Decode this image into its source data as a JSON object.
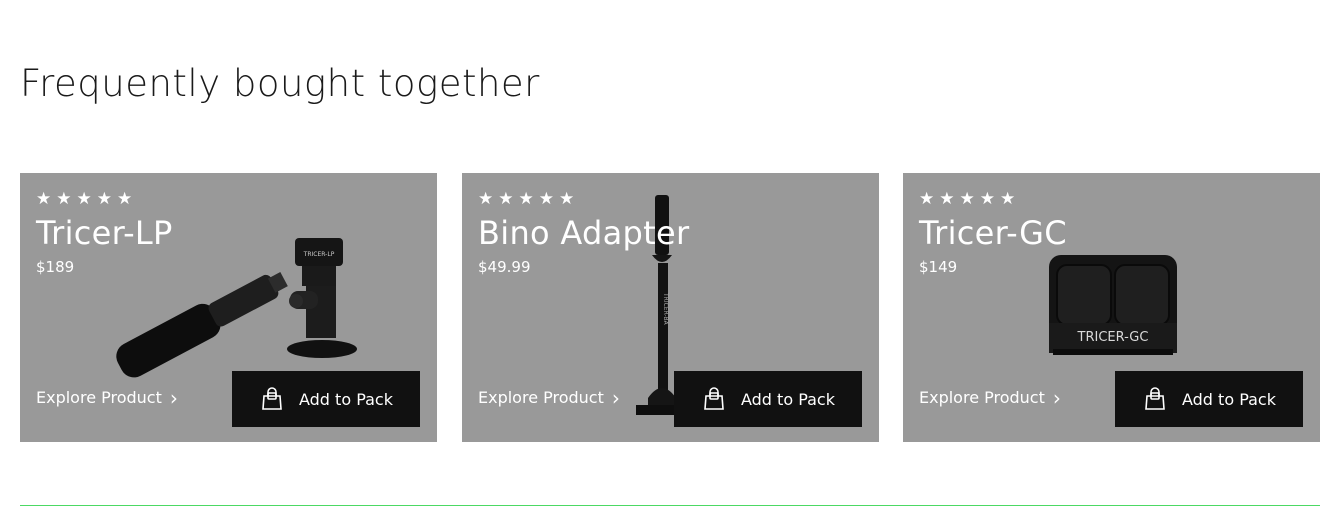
{
  "section": {
    "title": "Frequently bought together"
  },
  "products": [
    {
      "stars": "★★★★★",
      "name": "Tricer-LP",
      "price": "$189",
      "explore_label": "Explore Product",
      "chevron": "›",
      "add_label": "Add to Pack",
      "image_label": "TRICER-LP"
    },
    {
      "stars": "★★★★★",
      "name": "Bino Adapter",
      "price": "$49.99",
      "explore_label": "Explore Product",
      "chevron": "›",
      "add_label": "Add to Pack",
      "image_label": "TRICER-BA"
    },
    {
      "stars": "★★★★★",
      "name": "Tricer-GC",
      "price": "$149",
      "explore_label": "Explore Product",
      "chevron": "›",
      "add_label": "Add to Pack",
      "image_label": "TRICER-GC"
    }
  ],
  "colors": {
    "card_bg": "#999999",
    "button_bg": "#111111",
    "divider": "#4cd964"
  }
}
